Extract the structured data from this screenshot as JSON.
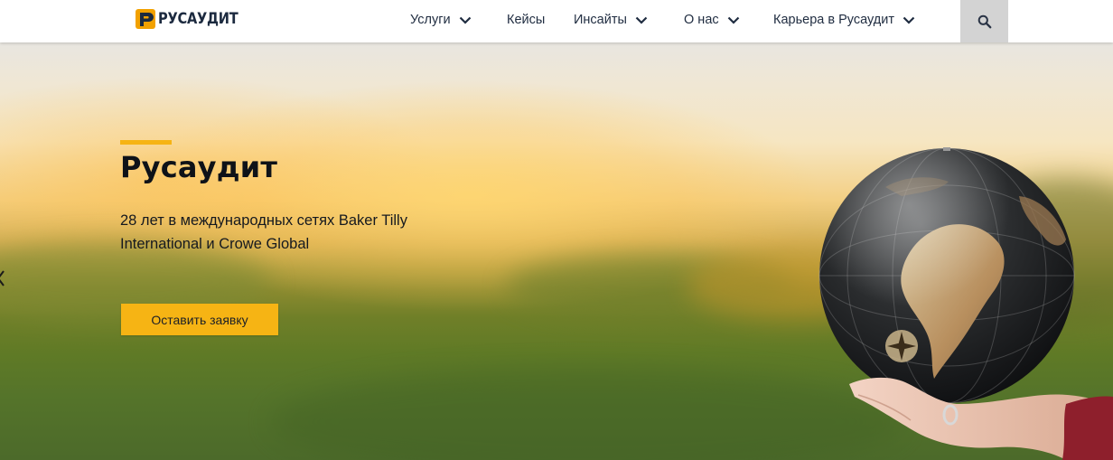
{
  "brand": {
    "name": "РУСАУДИТ"
  },
  "nav": {
    "items": [
      {
        "label": "Услуги",
        "has_dropdown": true
      },
      {
        "label": "Кейсы",
        "has_dropdown": false
      },
      {
        "label": "Инсайты",
        "has_dropdown": true
      },
      {
        "label": "О нас",
        "has_dropdown": true
      },
      {
        "label": "Карьера в Русаудит",
        "has_dropdown": true
      }
    ],
    "search_icon": "search-icon"
  },
  "hero": {
    "title": "Русаудит",
    "subtitle": "28 лет в международных сетях Baker Tilly International и Crowe Global",
    "cta_label": "Оставить заявку",
    "image": "globe-in-hand"
  },
  "colors": {
    "accent": "#f6b414",
    "text_dark": "#1f2c40",
    "search_bg": "#d3d3d3",
    "logo_orange": "#f2a100",
    "logo_navy": "#1c2a3f"
  }
}
